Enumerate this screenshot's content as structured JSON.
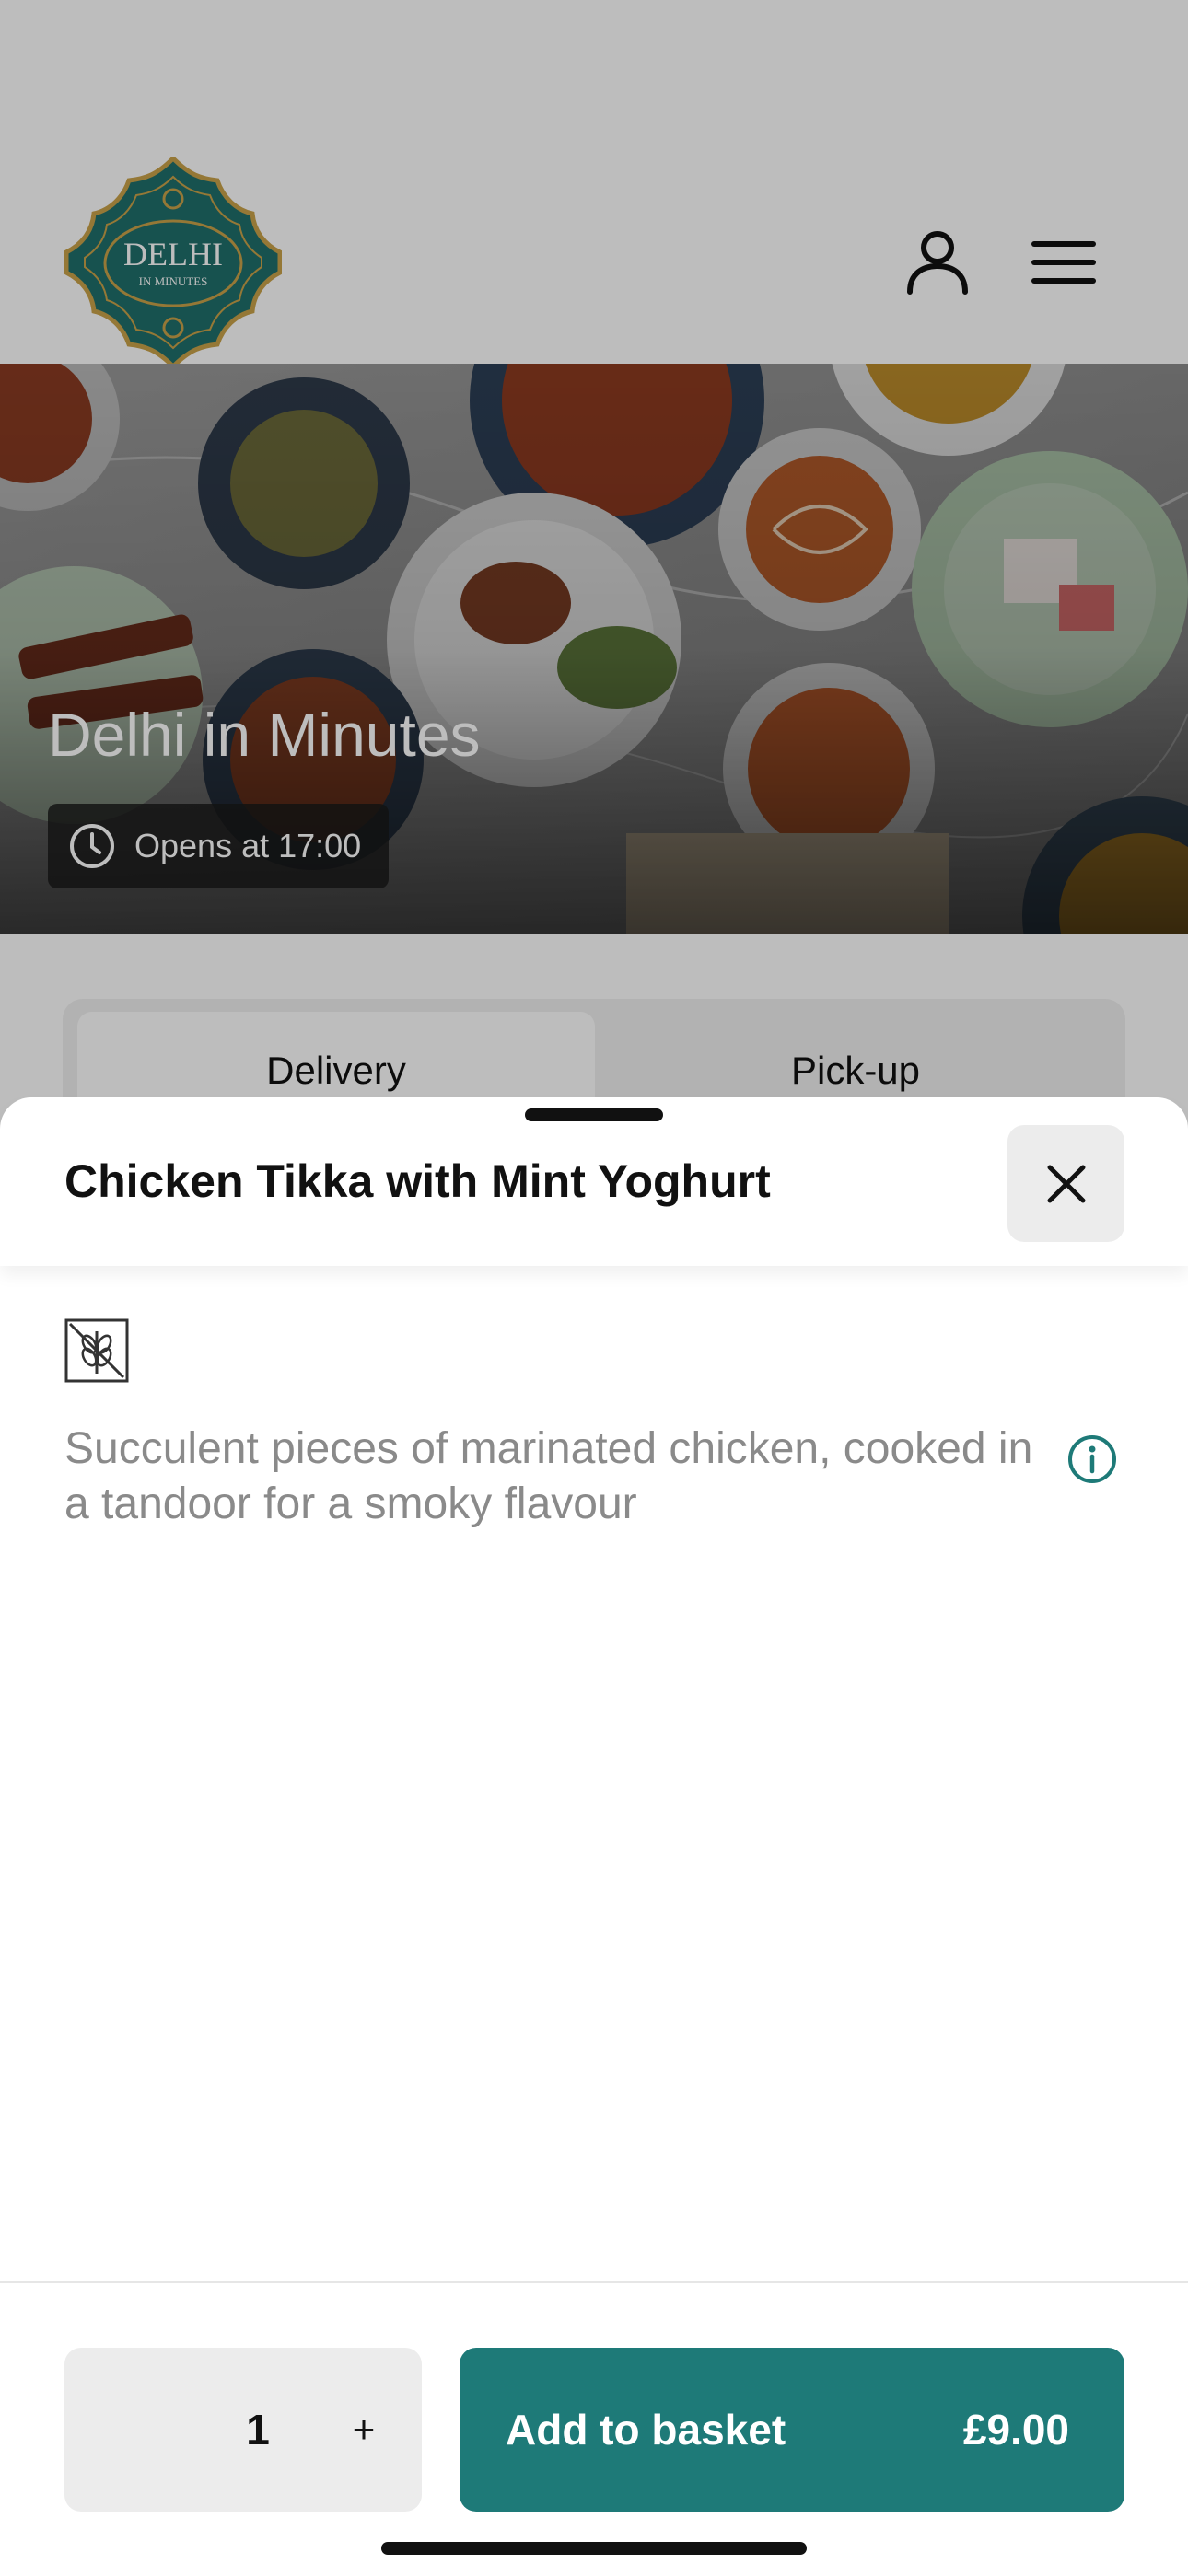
{
  "brand": {
    "logo_line1": "DELHI",
    "logo_line2": "IN MINUTES"
  },
  "hero": {
    "restaurant_name": "Delhi in Minutes",
    "hours": "Opens at 17:00"
  },
  "fulfilment": {
    "tabs": [
      "Delivery",
      "Pick-up"
    ],
    "selected": "Delivery"
  },
  "item": {
    "title": "Chicken Tikka with Mint Yoghurt",
    "description": "Succulent pieces of marinated chicken, cooked in a tandoor for a smoky flavour",
    "diet_icon": "gluten-free-icon"
  },
  "footer": {
    "quantity": "1",
    "plus": "+",
    "add_label": "Add to basket",
    "price": "£9.00"
  },
  "colors": {
    "accent": "#1e7a78",
    "logo_teal": "#1f6f6b",
    "logo_gold": "#c9a24a"
  }
}
